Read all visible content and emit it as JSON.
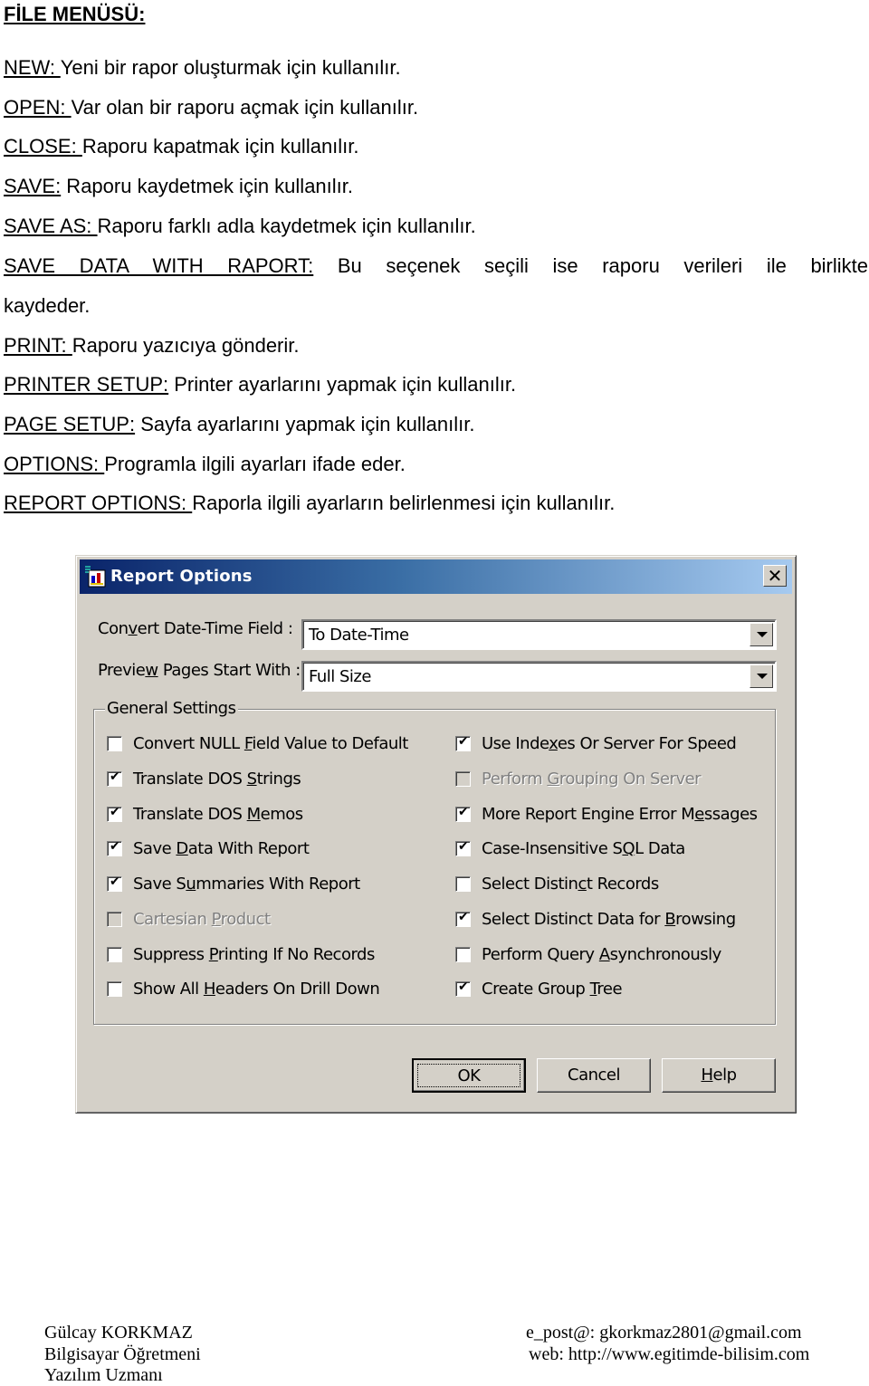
{
  "heading": "FİLE MENÜSÜ:",
  "items": [
    {
      "key": "NEW: ",
      "desc": "Yeni bir rapor oluşturmak için kullanılır."
    },
    {
      "key": "OPEN: ",
      "desc": "Var olan bir raporu açmak için kullanılır."
    },
    {
      "key": "CLOSE: ",
      "desc": "Raporu kapatmak için kullanılır."
    },
    {
      "key": "SAVE:",
      "desc": " Raporu kaydetmek için kullanılır."
    },
    {
      "key": "SAVE AS: ",
      "desc": "Raporu farklı adla kaydetmek için kullanılır."
    },
    {
      "key": "SAVE DATA WITH RAPORT:",
      "desc": " Bu seçenek seçili ise raporu verileri ile birlikte",
      "continuation": "kaydeder."
    },
    {
      "key": "PRINT: ",
      "desc": "Raporu yazıcıya gönderir."
    },
    {
      "key": "PRINTER SETUP:",
      "desc": " Printer ayarlarını yapmak için kullanılır."
    },
    {
      "key": "PAGE SETUP:",
      "desc": " Sayfa ayarlarını yapmak için kullanılır."
    },
    {
      "key": "OPTIONS: ",
      "desc": "Programla ilgili ayarları ifade eder."
    },
    {
      "key": "REPORT OPTIONS: ",
      "desc": "Raporla ilgili ayarların belirlenmesi için kullanılır."
    }
  ],
  "dialog": {
    "title": "Report Options",
    "close_glyph": "✕",
    "convert_label": {
      "pre": "Con",
      "u": "v",
      "post": "ert Date-Time Field :"
    },
    "convert_value": "To Date-Time",
    "preview_label": {
      "pre": "Previe",
      "u": "w",
      "post": " Pages Start With :"
    },
    "preview_value": "Full Size",
    "group_label": "General Settings",
    "left_options": [
      {
        "pre": "Convert NULL ",
        "u": "F",
        "post": "ield Value to Default",
        "checked": false,
        "disabled": false
      },
      {
        "pre": "Translate DOS ",
        "u": "S",
        "post": "trings",
        "checked": true,
        "disabled": false
      },
      {
        "pre": "Translate DOS ",
        "u": "M",
        "post": "emos",
        "checked": true,
        "disabled": false
      },
      {
        "pre": "Save ",
        "u": "D",
        "post": "ata With Report",
        "checked": true,
        "disabled": false
      },
      {
        "pre": "Save S",
        "u": "u",
        "post": "mmaries With Report",
        "checked": true,
        "disabled": false
      },
      {
        "pre": "Cartesian ",
        "u": "P",
        "post": "roduct",
        "checked": false,
        "disabled": true
      },
      {
        "pre": "Suppress ",
        "u": "P",
        "post": "rinting If No Records",
        "checked": false,
        "disabled": false
      },
      {
        "pre": "Show All ",
        "u": "H",
        "post": "eaders On Drill Down",
        "checked": false,
        "disabled": false
      }
    ],
    "right_options": [
      {
        "pre": "Use Inde",
        "u": "x",
        "post": "es Or Server For Speed",
        "checked": true,
        "disabled": false
      },
      {
        "pre": "Perform ",
        "u": "G",
        "post": "rouping On Server",
        "checked": false,
        "disabled": true
      },
      {
        "pre": "More Report Engine Error M",
        "u": "e",
        "post": "ssages",
        "checked": true,
        "disabled": false
      },
      {
        "pre": "Case-Insensitive S",
        "u": "Q",
        "post": "L Data",
        "checked": true,
        "disabled": false
      },
      {
        "pre": "Select Distin",
        "u": "c",
        "post": "t Records",
        "checked": false,
        "disabled": false
      },
      {
        "pre": "Select Distinct Data for ",
        "u": "B",
        "post": "rowsing",
        "checked": true,
        "disabled": false
      },
      {
        "pre": "Perform Query ",
        "u": "A",
        "post": "synchronously",
        "checked": false,
        "disabled": false
      },
      {
        "pre": "Create Group ",
        "u": "T",
        "post": "ree",
        "checked": true,
        "disabled": false
      }
    ],
    "buttons": {
      "ok": "OK",
      "cancel": "Cancel",
      "help": {
        "u": "H",
        "post": "elp"
      }
    }
  },
  "footer": {
    "name": "Gülcay KORKMAZ",
    "role1": "Bilgisayar Öğretmeni",
    "role2": "Yazılım Uzmanı",
    "email": "e_post@: gkorkmaz2801@gmail.com",
    "web": "web:  http://www.egitimde-bilisim.com"
  }
}
